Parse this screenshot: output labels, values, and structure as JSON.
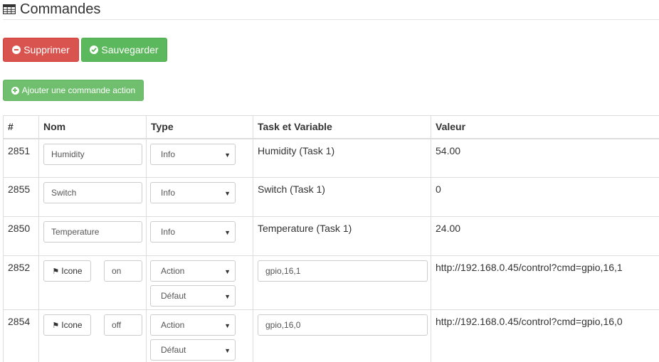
{
  "header": {
    "icon": "table-icon",
    "title": "Commandes"
  },
  "buttons": {
    "delete_label": "Supprimer",
    "save_label": "Sauvegarder",
    "add_action_label": "Ajouter une commande action"
  },
  "table": {
    "headers": {
      "id": "#",
      "name": "Nom",
      "type": "Type",
      "task": "Task et Variable",
      "value": "Valeur"
    },
    "rows": [
      {
        "id": "2851",
        "name": "Humidity",
        "type": "Info",
        "task": "Humidity (Task 1)",
        "value": "54.00"
      },
      {
        "id": "2855",
        "name": "Switch",
        "type": "Info",
        "task": "Switch (Task 1)",
        "value": "0"
      },
      {
        "id": "2850",
        "name": "Temperature",
        "type": "Info",
        "task": "Temperature (Task 1)",
        "value": "24.00"
      },
      {
        "id": "2852",
        "icon_label": "Icone",
        "name": "on",
        "type": "Action",
        "subtype": "Défaut",
        "task": "gpio,16,1",
        "value": "http://192.168.0.45/control?cmd=gpio,16,1"
      },
      {
        "id": "2854",
        "icon_label": "Icone",
        "name": "off",
        "type": "Action",
        "subtype": "Défaut",
        "task": "gpio,16,0",
        "value": "http://192.168.0.45/control?cmd=gpio,16,0"
      }
    ]
  },
  "colors": {
    "danger": "#d9534f",
    "success": "#5cb85c",
    "add": "#6fbf6f"
  }
}
